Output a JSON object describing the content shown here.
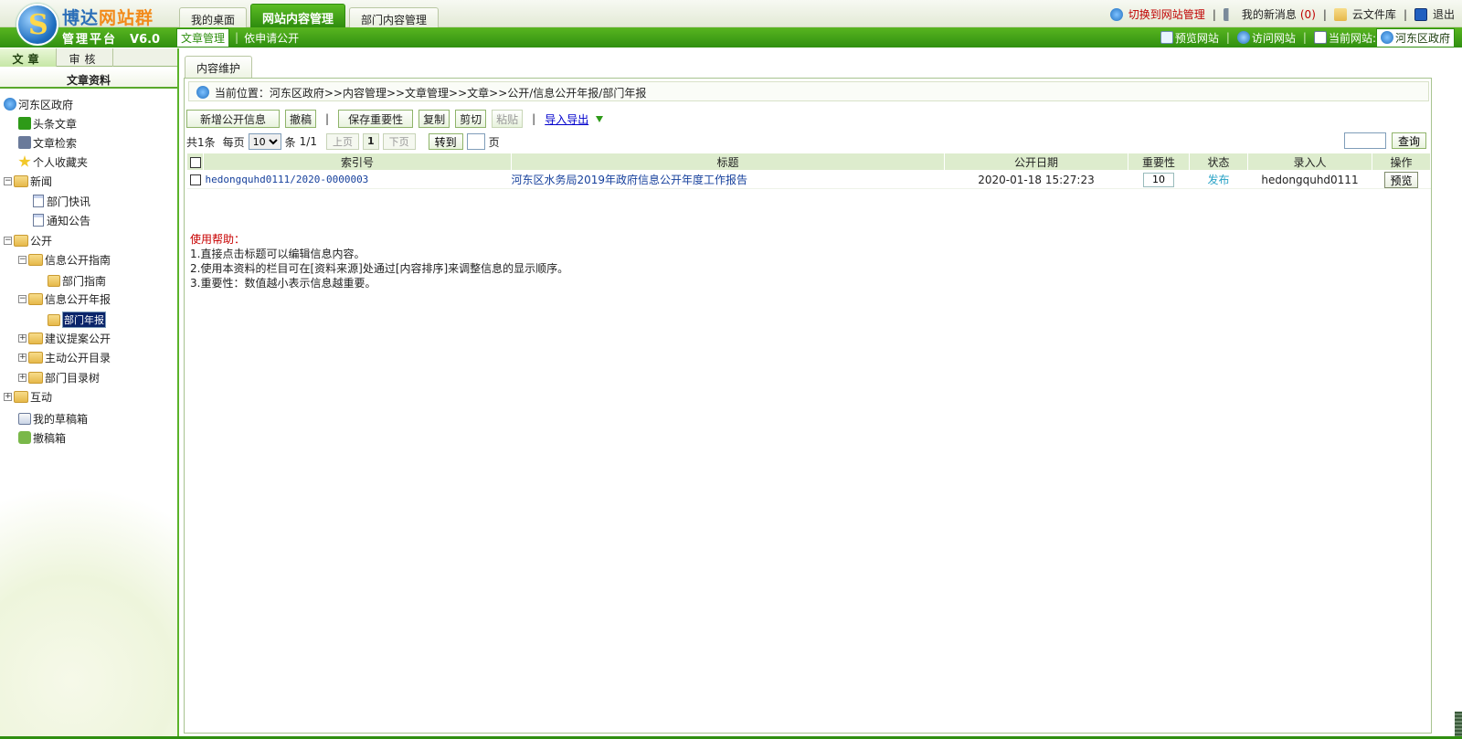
{
  "header": {
    "brand_part1": "博达",
    "brand_part2": "网站群",
    "platform": "管理平台",
    "version": "V6.0",
    "tabs": [
      "我的桌面",
      "网站内容管理",
      "部门内容管理"
    ],
    "links": {
      "switch": "切换到网站管理",
      "messages": "我的新消息",
      "message_count": "(0)",
      "cloud": "云文件库",
      "logout": "退出"
    },
    "sub_left": [
      "文章管理",
      "依申请公开"
    ],
    "sub_right": {
      "preview": "预览网站",
      "visit": "访问网站",
      "current_label": "当前网站:",
      "current_site": "河东区政府"
    }
  },
  "left": {
    "tabs": [
      "文章",
      "审核"
    ],
    "heading": "文章资料",
    "tree": [
      {
        "label": "河东区政府"
      },
      {
        "label": "头条文章"
      },
      {
        "label": "文章检索"
      },
      {
        "label": "个人收藏夹"
      },
      {
        "label": "新闻",
        "toggle": "−"
      },
      {
        "label": "部门快讯"
      },
      {
        "label": "通知公告"
      },
      {
        "label": "公开",
        "toggle": "−"
      },
      {
        "label": "信息公开指南",
        "toggle": "−"
      },
      {
        "label": "部门指南"
      },
      {
        "label": "信息公开年报",
        "toggle": "−"
      },
      {
        "label": "部门年报"
      },
      {
        "label": "建议提案公开",
        "toggle": "+"
      },
      {
        "label": "主动公开目录",
        "toggle": "+"
      },
      {
        "label": "部门目录树",
        "toggle": "+"
      },
      {
        "label": "互动",
        "toggle": "+"
      },
      {
        "label": "我的草稿箱"
      },
      {
        "label": "撤稿箱"
      }
    ]
  },
  "content": {
    "tab": "内容维护",
    "breadcrumb": "当前位置：河东区政府>>内容管理>>文章管理>>文章>>公开/信息公开年报/部门年报",
    "toolbar": {
      "add": "新增公开信息",
      "withdraw": "撤稿",
      "save_importance": "保存重要性",
      "copy": "复制",
      "cut": "剪切",
      "paste": "粘贴",
      "import_export": "导入导出"
    },
    "pager": {
      "total": "共1条",
      "per_page_label": "每页",
      "per_page": "10",
      "unit": "条",
      "pages": "1/1",
      "prev": "上页",
      "current": "1",
      "next": "下页",
      "goto": "转到",
      "page_word": "页"
    },
    "search_btn": "查询",
    "table": {
      "headers": [
        "索引号",
        "标题",
        "公开日期",
        "重要性",
        "状态",
        "录入人",
        "操作"
      ],
      "rows": [
        {
          "index": "hedongquhd0111/2020-0000003",
          "title": "河东区水务局2019年政府信息公开年度工作报告",
          "date": "2020-01-18 15:27:23",
          "importance": "10",
          "status": "发布",
          "author": "hedongquhd0111",
          "action": "预览"
        }
      ]
    },
    "help": {
      "title": "使用帮助：",
      "lines": [
        "1.直接点击标题可以编辑信息内容。",
        "2.使用本资料的栏目可在[资料来源]处通过[内容排序]来调整信息的显示顺序。",
        "3.重要性：数值越小表示信息越重要。"
      ]
    }
  },
  "colors": {
    "brand_green": "#2f8f10",
    "brand_blue": "#2c6fb8",
    "brand_orange": "#f28a1a",
    "status_blue": "#2aa3c6",
    "help_red": "#c80000"
  }
}
